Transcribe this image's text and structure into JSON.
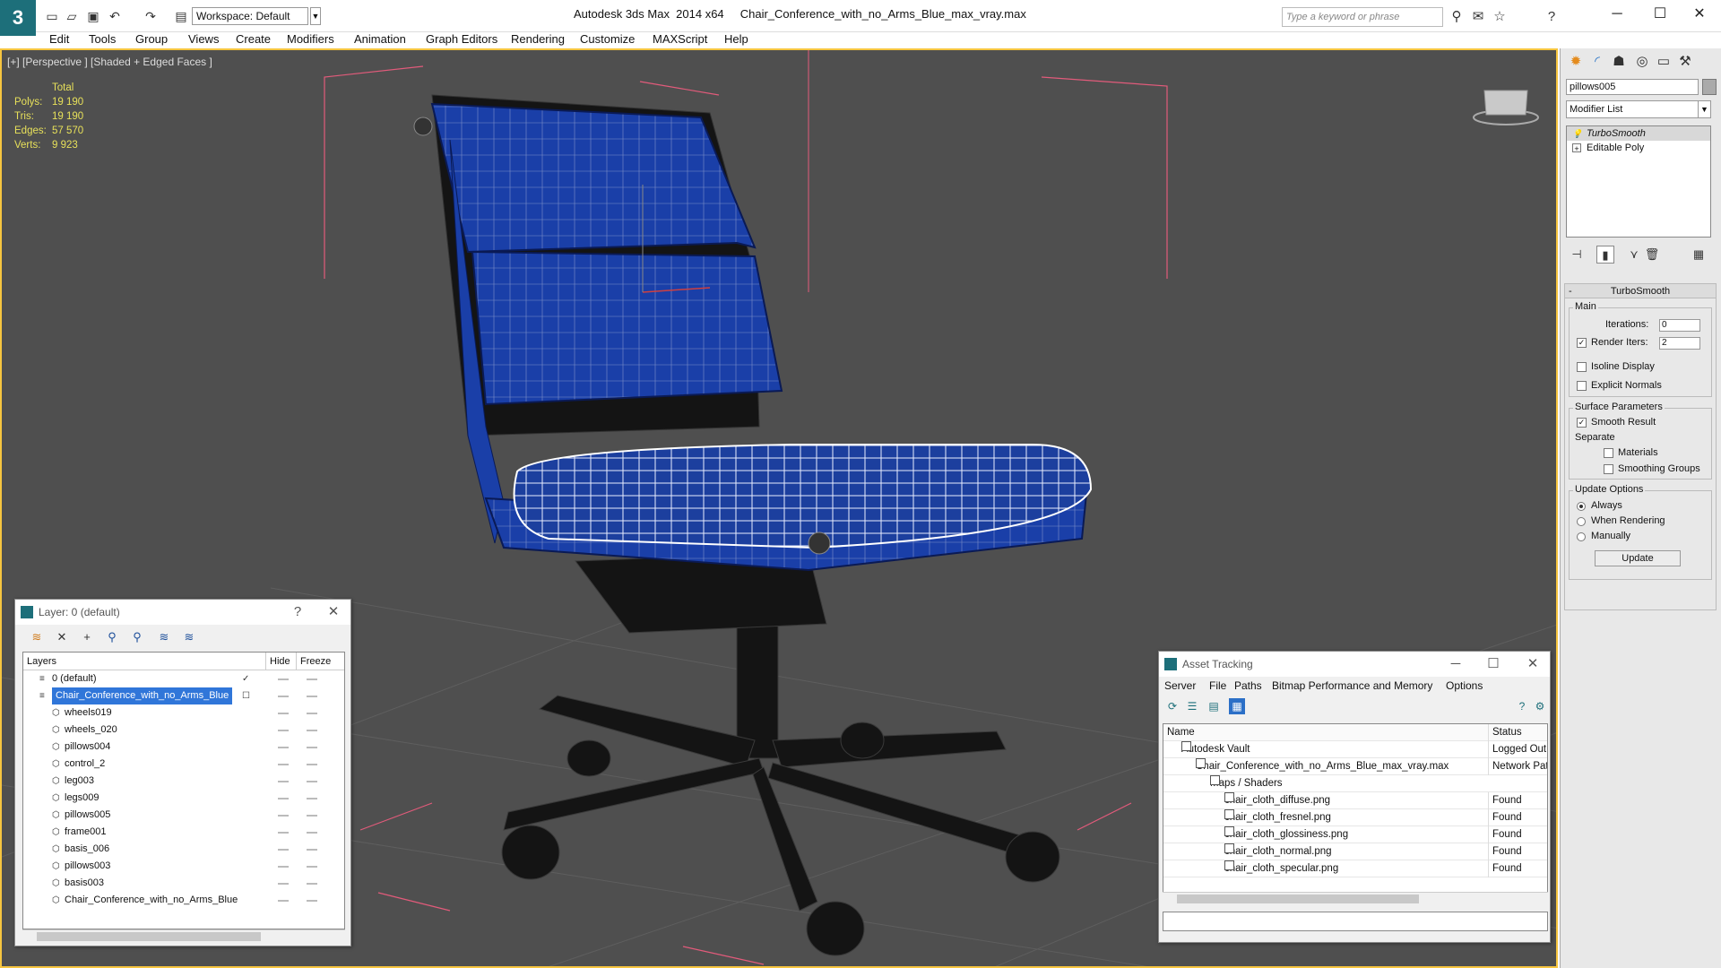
{
  "app": {
    "title": "Autodesk 3ds Max  2014 x64     Chair_Conference_with_no_Arms_Blue_max_vray.max",
    "workspace": "Workspace: Default",
    "search_placeholder": "Type a keyword or phrase"
  },
  "menu": [
    "Edit",
    "Tools",
    "Group",
    "Views",
    "Create",
    "Modifiers",
    "Animation",
    "Graph Editors",
    "Rendering",
    "Customize",
    "MAXScript",
    "Help"
  ],
  "viewport": {
    "label": "[+] [Perspective ] [Shaded + Edged Faces ]",
    "stats": {
      "header": "Total",
      "rows": [
        {
          "k": "Polys:",
          "v": "19 190"
        },
        {
          "k": "Tris:",
          "v": "19 190"
        },
        {
          "k": "Edges:",
          "v": "57 570"
        },
        {
          "k": "Verts:",
          "v": "9 923"
        }
      ]
    },
    "colors": {
      "background": "#4f4f4f",
      "border": "#f6c53f",
      "stats": "#e7e05a",
      "chair": "#1a3fa8",
      "bounds": "#e25b7b"
    }
  },
  "command_panel": {
    "object_name": "pillows005",
    "modifier_list": "Modifier List",
    "stack": [
      {
        "label": "TurboSmooth",
        "selected": true
      },
      {
        "label": "Editable Poly",
        "selected": false
      }
    ],
    "rollout": {
      "title": "TurboSmooth",
      "main_label": "Main",
      "iterations_label": "Iterations:",
      "iterations_value": "0",
      "render_iters_label": "Render Iters:",
      "render_iters_value": "2",
      "isoline": "Isoline Display",
      "explicit_normals": "Explicit Normals",
      "surface_params": "Surface Parameters",
      "smooth_result": "Smooth Result",
      "separate": "Separate",
      "materials": "Materials",
      "smoothing_groups": "Smoothing Groups",
      "update_options": "Update Options",
      "always": "Always",
      "when_rendering": "When Rendering",
      "manually": "Manually",
      "update_button": "Update"
    }
  },
  "layer_dialog": {
    "title": "Layer: 0 (default)",
    "help": "?",
    "columns": {
      "layers": "Layers",
      "hide": "Hide",
      "freeze": "Freeze"
    },
    "rows": [
      {
        "name": "0 (default)",
        "level": 0,
        "selected": false,
        "checked": true
      },
      {
        "name": "Chair_Conference_with_no_Arms_Blue",
        "level": 0,
        "selected": true,
        "checked": false
      },
      {
        "name": "wheels019",
        "level": 1
      },
      {
        "name": "wheels_020",
        "level": 1
      },
      {
        "name": "pillows004",
        "level": 1
      },
      {
        "name": "control_2",
        "level": 1
      },
      {
        "name": "leg003",
        "level": 1
      },
      {
        "name": "legs009",
        "level": 1
      },
      {
        "name": "pillows005",
        "level": 1
      },
      {
        "name": "frame001",
        "level": 1
      },
      {
        "name": "basis_006",
        "level": 1
      },
      {
        "name": "pillows003",
        "level": 1
      },
      {
        "name": "basis003",
        "level": 1
      },
      {
        "name": "Chair_Conference_with_no_Arms_Blue",
        "level": 1
      }
    ]
  },
  "asset_tracking": {
    "title": "Asset Tracking",
    "menu": [
      "Server",
      "File",
      "Paths",
      "Bitmap Performance and Memory",
      "Options"
    ],
    "columns": {
      "name": "Name",
      "status": "Status"
    },
    "rows": [
      {
        "name": "Autodesk Vault",
        "status": "Logged Out",
        "indent": 1
      },
      {
        "name": "Chair_Conference_with_no_Arms_Blue_max_vray.max",
        "status": "Network Pat",
        "indent": 2
      },
      {
        "name": "Maps / Shaders",
        "status": "",
        "indent": 3
      },
      {
        "name": "chair_cloth_diffuse.png",
        "status": "Found",
        "indent": 4
      },
      {
        "name": "chair_cloth_fresnel.png",
        "status": "Found",
        "indent": 4
      },
      {
        "name": "chair_cloth_glossiness.png",
        "status": "Found",
        "indent": 4
      },
      {
        "name": "chair_cloth_normal.png",
        "status": "Found",
        "indent": 4
      },
      {
        "name": "chair_cloth_specular.png",
        "status": "Found",
        "indent": 4
      }
    ]
  }
}
